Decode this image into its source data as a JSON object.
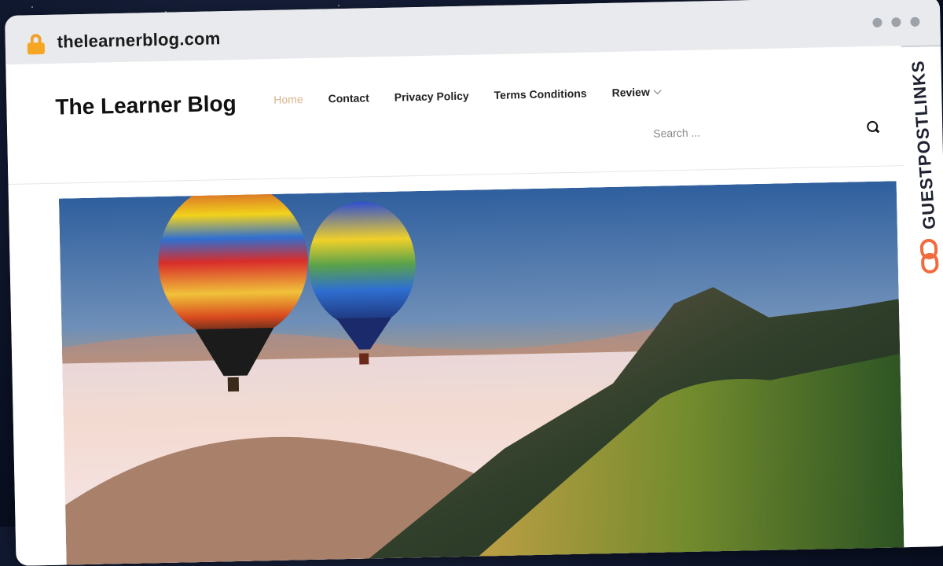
{
  "browser": {
    "url": "thelearnerblog.com",
    "lock_icon": "lock-icon"
  },
  "site": {
    "title": "The Learner Blog",
    "nav": [
      {
        "label": "Home",
        "active": true
      },
      {
        "label": "Contact",
        "active": false
      },
      {
        "label": "Privacy Policy",
        "active": false
      },
      {
        "label": "Terms Conditions",
        "active": false
      },
      {
        "label": "Review",
        "active": false,
        "has_dropdown": true
      }
    ],
    "search": {
      "placeholder": "Search ...",
      "icon": "search-icon"
    }
  },
  "hero": {
    "icon": "hero-image-hot-air-balloons-over-mountains"
  },
  "watermark": {
    "text": "GUESTPOSTLINKS",
    "accent": "#f26a3d"
  }
}
